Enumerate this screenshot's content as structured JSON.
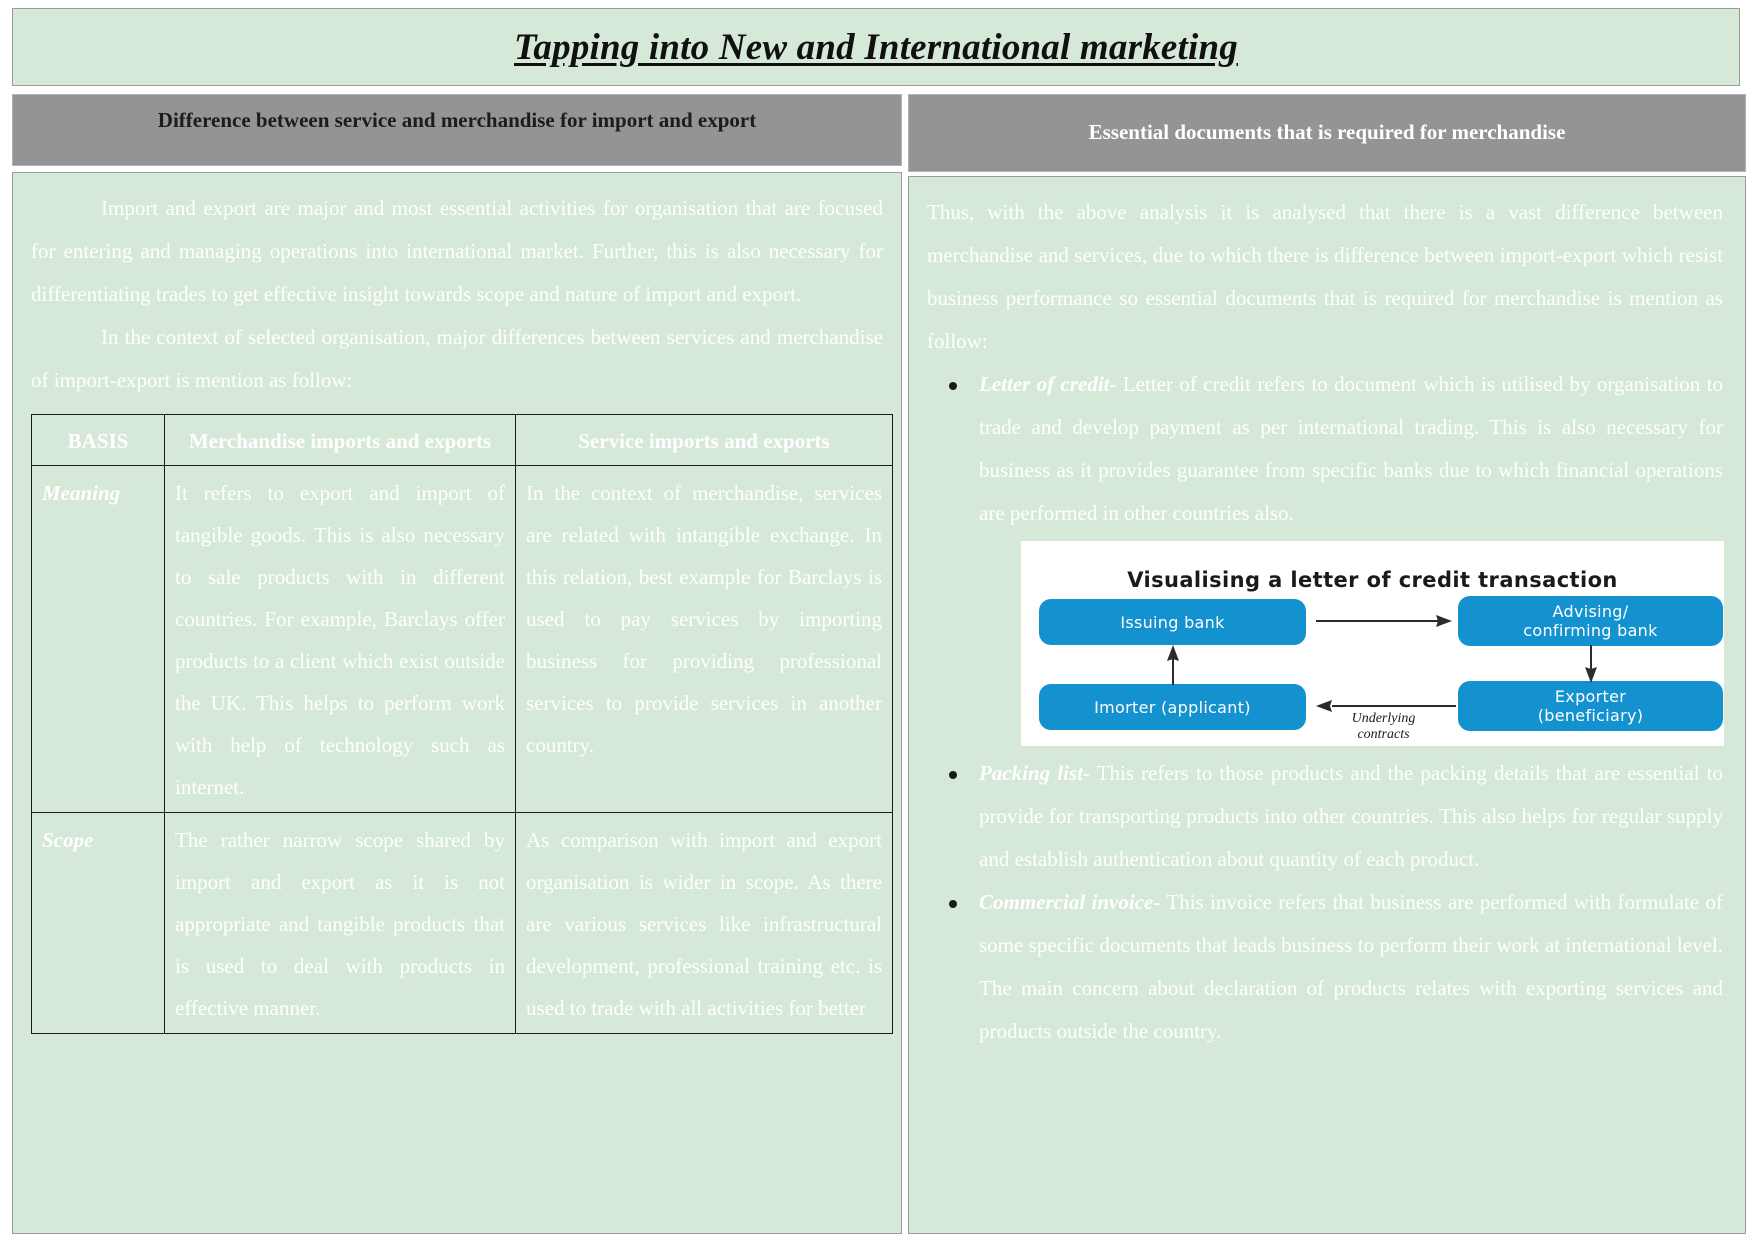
{
  "document": {
    "title": "Tapping into New and International marketing"
  },
  "left_column": {
    "header": "Difference between service and merchandise for import and export",
    "paragraphs": [
      "Import and export are major and most essential activities for organisation that are focused for entering and managing operations into international market. Further, this is also necessary for differentiating trades to get effective insight towards scope and nature of import and export.",
      "In the context of selected organisation, major differences between services and merchandise of import-export is mention as follow:"
    ],
    "table": {
      "headers": [
        "BASIS",
        "Merchandise imports and exports",
        "Service imports and exports"
      ],
      "rows": [
        {
          "basis": "Meaning",
          "merchandise": "It refers to export and import of tangible goods. This is also necessary to sale products with in different countries. For example, Barclays offer products to a client which exist outside the UK. This helps to perform work with help of technology such as internet.",
          "service": "In the context of merchandise, services are related with intangible exchange. In this relation, best example for Barclays is used to pay services by importing business for providing professional services to provide services in another country."
        },
        {
          "basis": "Scope",
          "merchandise": "The rather narrow scope shared by import and export as it is not appropriate and tangible products that is used to deal with products in effective manner.",
          "service": "As comparison with import and export organisation is wider in scope. As there are various services like infrastructural development, professional training etc. is used to trade with all activities for better"
        }
      ]
    }
  },
  "right_column": {
    "header": "Essential documents that is required for merchandise",
    "intro": "Thus, with the above analysis it is analysed that there is a vast difference between merchandise and services, due to which there is difference between import-export which resist business performance so essential documents that is required for merchandise is mention as follow:",
    "documents": [
      {
        "term": "Letter of credit-",
        "text": " Letter of credit refers to document which is utilised by organisation to trade and develop payment as per international trading. This is also necessary for business as it provides guarantee from specific banks due to which financial operations are performed in other countries also."
      },
      {
        "term": "Packing list-",
        "text": " This refers to those products and the packing details that are essential to provide for transporting products into other countries. This also helps for regular supply and establish authentication about quantity of each product."
      },
      {
        "term": "Commercial invoice-",
        "text": " This invoice refers that business are performed with formulate of some specific documents that leads business to perform their work at international level. The main concern about declaration of products relates with exporting services and products outside the country."
      }
    ],
    "figure": {
      "title": "Visualising a letter of credit transaction",
      "boxes": {
        "issuing_bank": "Issuing bank",
        "advising_bank": "Advising/\nconfirming bank",
        "importer": "Imorter (applicant)",
        "exporter": "Exporter\n(beneficiary)"
      },
      "advising_bank_line1": "Advising/",
      "advising_bank_line2": "confirming bank",
      "exporter_line1": "Exporter",
      "exporter_line2": "(beneficiary)",
      "edge_label_line1": "Underlying",
      "edge_label_line2": "contracts",
      "box_color": "#1492cf"
    }
  },
  "theme": {
    "panel_bg": "#d6e8d8",
    "header_bar_bg": "#949494",
    "body_text_color": "#ffffff"
  }
}
